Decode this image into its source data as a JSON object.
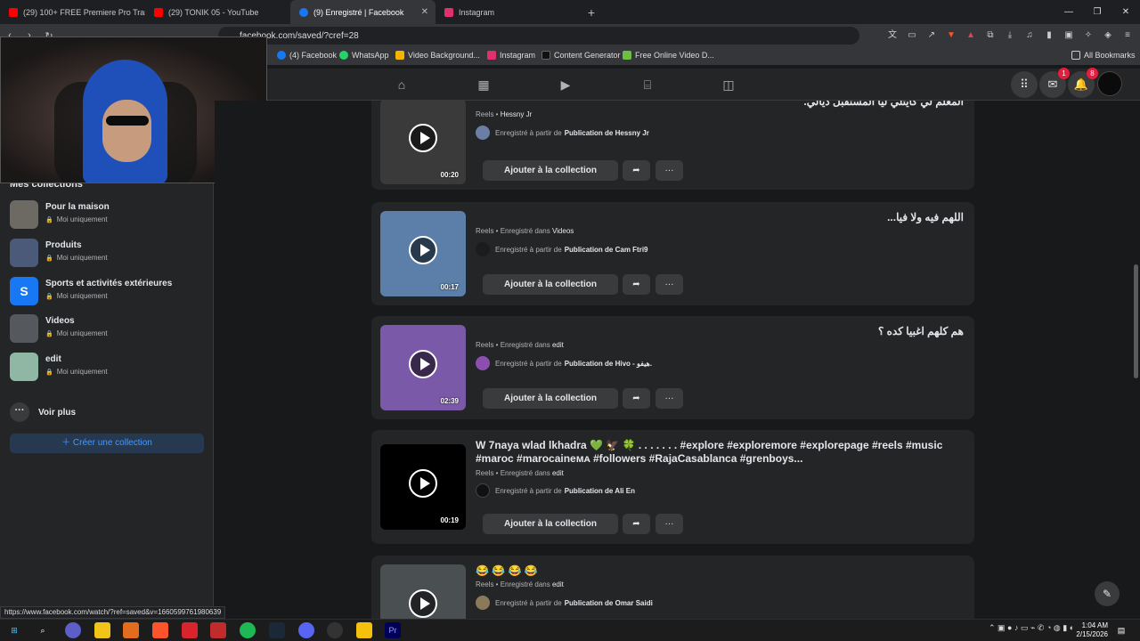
{
  "browser": {
    "tabs": [
      {
        "label": "(29) 100+ FREE Premiere Pro Transiti",
        "color": "#ff0000"
      },
      {
        "label": "(29) TONIK 05 - YouTube",
        "color": "#ff0000"
      },
      {
        "label": "(9) Enregistré | Facebook",
        "color": "#1877f2"
      },
      {
        "label": "Instagram",
        "color": "#e1306c"
      }
    ],
    "new_tab": "+",
    "url": "facebook.com/saved/?cref=28",
    "bookmarks": [
      {
        "label": "(4) Facebook",
        "color": "#1877f2"
      },
      {
        "label": "WhatsApp",
        "color": "#25d366"
      },
      {
        "label": "Video Background...",
        "color": "#f5b400"
      },
      {
        "label": "Instagram",
        "color": "#e1306c"
      },
      {
        "label": "Content Generator",
        "color": "#111111"
      },
      {
        "label": "Free Online Video D...",
        "color": "#6fbe44"
      }
    ],
    "all_bookmarks": "All Bookmarks"
  },
  "fb": {
    "messenger_badge": "1",
    "notif_badge": "8"
  },
  "sidebar": {
    "section_title": "Mes collections",
    "collections": [
      {
        "name": "Pour la maison",
        "privacy": "Moi uniquement",
        "color": "#6d6a63"
      },
      {
        "name": "Produits",
        "privacy": "Moi uniquement",
        "color": "#4a5a78"
      },
      {
        "name": "Sports et activités extérieures",
        "privacy": "Moi uniquement",
        "color": "#1877f2",
        "letter": "S"
      },
      {
        "name": "Videos",
        "privacy": "Moi uniquement",
        "color": "#55585c"
      },
      {
        "name": "edit",
        "privacy": "Moi uniquement",
        "color": "#8fb7a3"
      }
    ],
    "see_more": "Voir plus",
    "create": "Créer une collection"
  },
  "saved": [
    {
      "title": "المعلم لي كايتلي ليا المستقبل ديالي.",
      "rtl": true,
      "meta_pre": "Reels • ",
      "meta_post": "Hessny Jr",
      "source_pre": "Enregistré à partir de",
      "source": "Publication de Hessny Jr",
      "duration": "00:20",
      "thumb": "#3a3a3a"
    },
    {
      "title": "اللهم فيه ولا فيا...",
      "rtl": true,
      "meta_pre": "Reels • Enregistré dans ",
      "meta_post": "Videos",
      "source_pre": "Enregistré à partir de",
      "source": "Publication de Cam Ftri9",
      "duration": "00:17",
      "thumb": "#5b7fa8"
    },
    {
      "title": "هم كلهم اغبيا كده ؟",
      "rtl": true,
      "meta_pre": "Reels • Enregistré dans ",
      "meta_post": "edit",
      "source_pre": "Enregistré à partir de",
      "source": "Publication de Hivo - هيفو.",
      "duration": "02:39",
      "thumb": "#7a5aa8"
    },
    {
      "title": "W 7naya wlad lkhadra 💚 🦅 🍀 . . . . . . . #explore #exploremore #explorepage #reels #music #maroc #marocaineᴍᴀ #followers #RajaCasablanca #grenboys...",
      "rtl": false,
      "meta_pre": "Reels • Enregistré dans ",
      "meta_post": "edit",
      "source_pre": "Enregistré à partir de",
      "source": "Publication de Ali En",
      "duration": "00:19",
      "thumb": "#000000"
    },
    {
      "title": "😂 😂 😂 😂",
      "rtl": false,
      "meta_pre": "Reels • Enregistré dans ",
      "meta_post": "edit",
      "source_pre": "Enregistré à partir de",
      "source": "Publication de Omar Saidi",
      "duration": "",
      "thumb": "#4a4f52"
    }
  ],
  "add_to_collection": "Ajouter à la collection",
  "more_label": "···",
  "status_url": "https://www.facebook.com/watch/?ref=saved&v=1660599761980639",
  "clock": {
    "time": "1:04 AM",
    "date": "2/15/2026"
  }
}
